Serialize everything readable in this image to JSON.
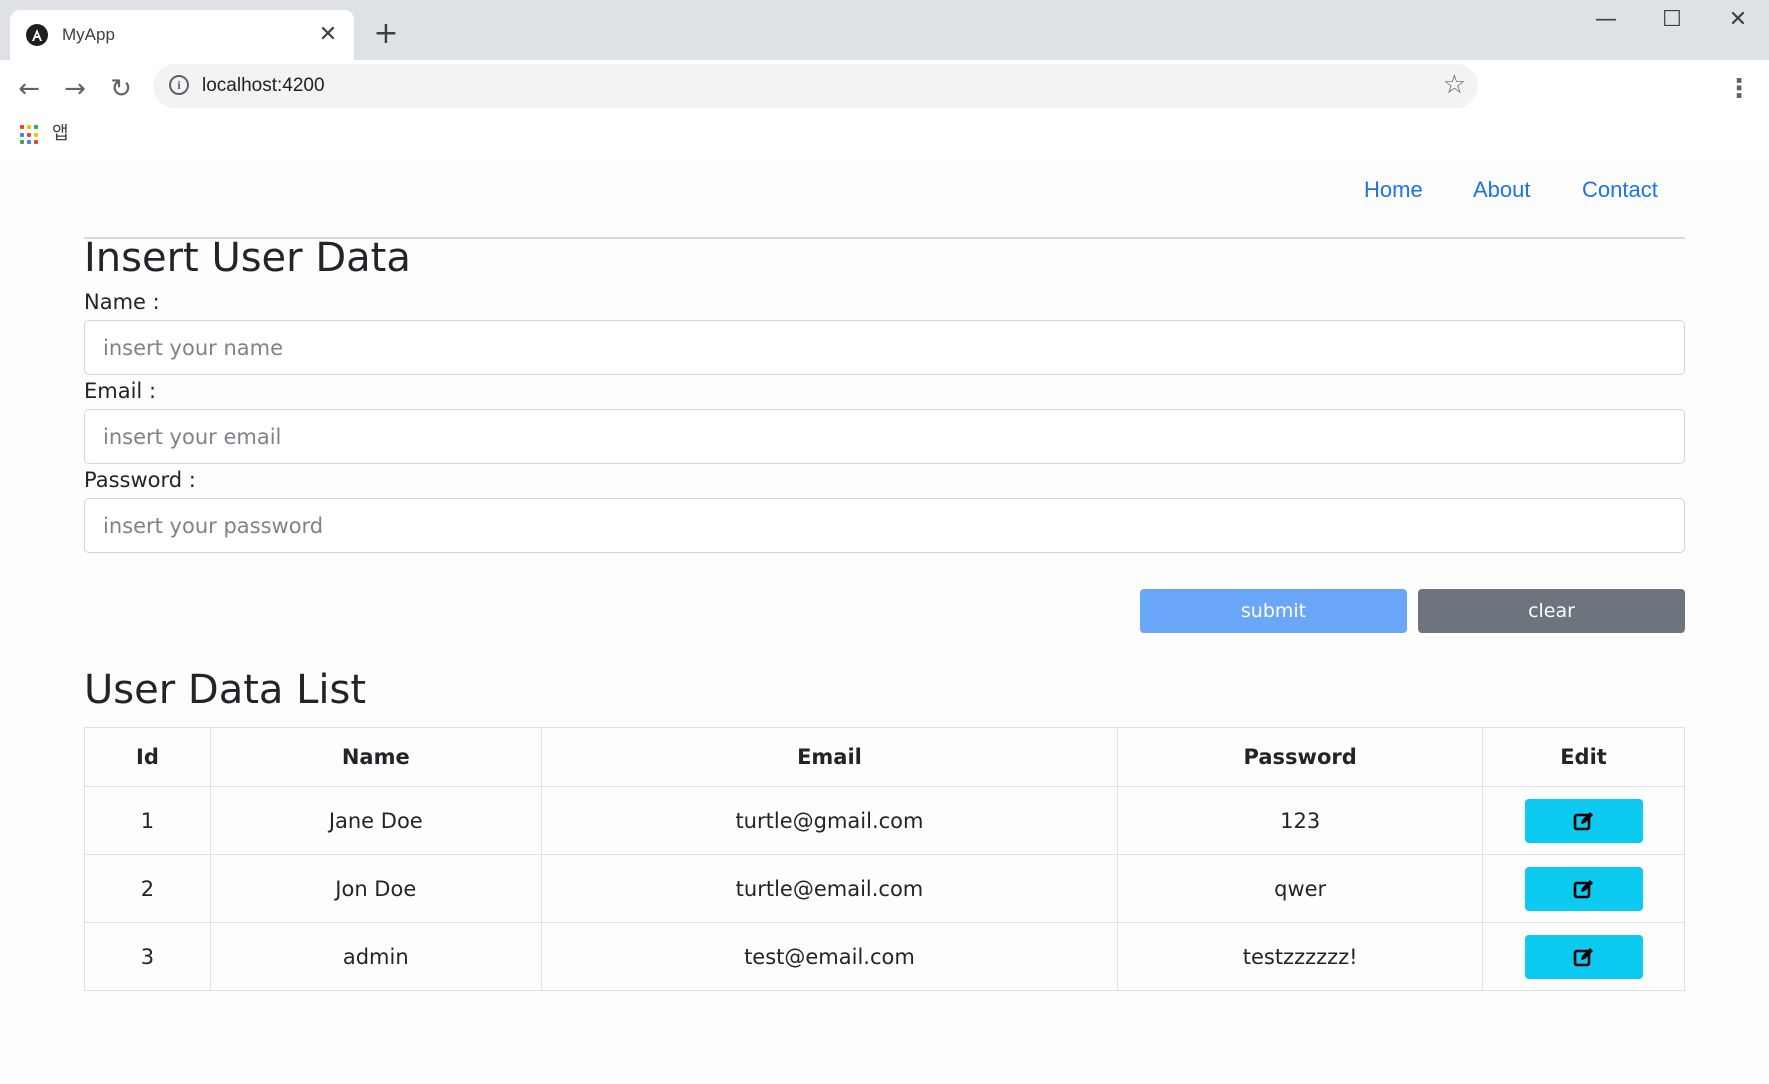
{
  "browser": {
    "tab_title": "MyApp",
    "tab_close": "✕",
    "new_tab": "+",
    "url": "localhost:4200",
    "bookmarks_apps_label": "앱",
    "window_controls": {
      "minimize": "—",
      "maximize": "☐",
      "close": "✕"
    }
  },
  "navbar": {
    "links": [
      "Home",
      "About",
      "Contact"
    ]
  },
  "form": {
    "title": "Insert User Data",
    "name_label": "Name :",
    "name_placeholder": "insert your name",
    "email_label": "Email :",
    "email_placeholder": "insert your email",
    "password_label": "Password :",
    "password_placeholder": "insert your password",
    "submit_label": "submit",
    "clear_label": "clear"
  },
  "list": {
    "title": "User Data List",
    "headers": [
      "Id",
      "Name",
      "Email",
      "Password",
      "Edit"
    ],
    "rows": [
      {
        "id": "1",
        "name": "Jane Doe",
        "email": "turtle@gmail.com",
        "password": "123"
      },
      {
        "id": "2",
        "name": "Jon Doe",
        "email": "turtle@email.com",
        "password": "qwer"
      },
      {
        "id": "3",
        "name": "admin",
        "email": "test@email.com",
        "password": "testzzzzzz!"
      }
    ]
  },
  "colors": {
    "link": "#1a73e8",
    "submit": "#6aa7f8",
    "clear": "#6c757d",
    "edit": "#0dcaf0"
  },
  "icons": {
    "favicon": "angular-icon",
    "info": "info-icon",
    "star": "star-icon",
    "edit": "edit-icon",
    "apps": "apps-grid-icon"
  }
}
